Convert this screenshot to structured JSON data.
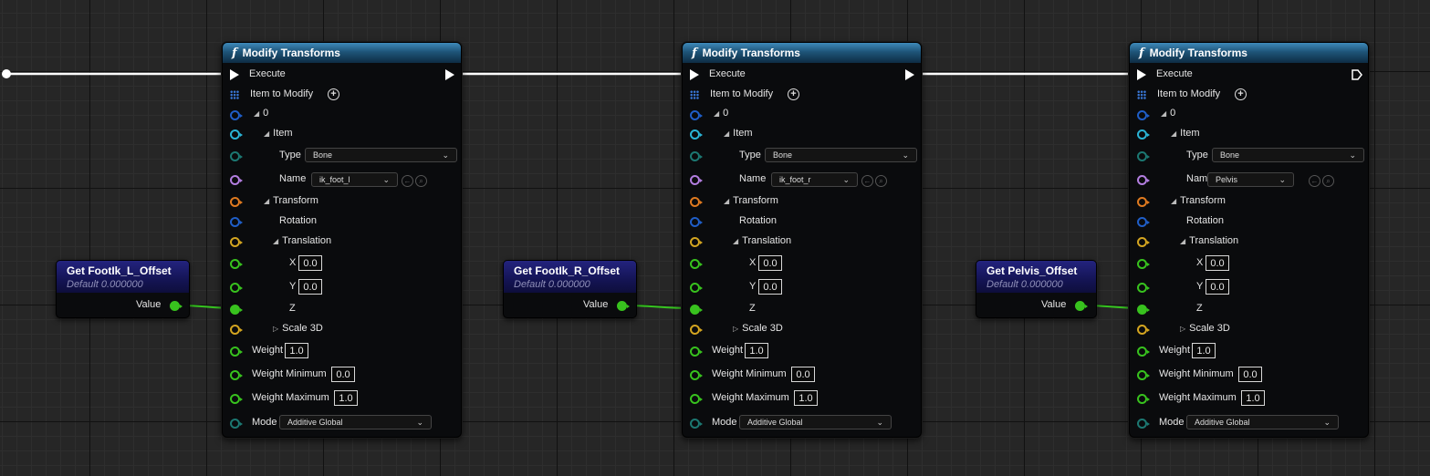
{
  "nodes": [
    {
      "title": "Modify Transforms",
      "execute_label": "Execute",
      "item_to_modify_label": "Item to Modify",
      "index_label": "0",
      "item_label": "Item",
      "type_label": "Type",
      "type_value": "Bone",
      "name_label": "Name",
      "name_value": "ik_foot_l",
      "transform_label": "Transform",
      "rotation_label": "Rotation",
      "translation_label": "Translation",
      "x_label": "X",
      "x_value": "0.0",
      "y_label": "Y",
      "y_value": "0.0",
      "z_label": "Z",
      "scale_label": "Scale 3D",
      "weight_label": "Weight",
      "weight_value": "1.0",
      "weight_min_label": "Weight Minimum",
      "weight_min_value": "0.0",
      "weight_max_label": "Weight Maximum",
      "weight_max_value": "1.0",
      "mode_label": "Mode",
      "mode_value": "Additive Global"
    },
    {
      "title": "Modify Transforms",
      "execute_label": "Execute",
      "item_to_modify_label": "Item to Modify",
      "index_label": "0",
      "item_label": "Item",
      "type_label": "Type",
      "type_value": "Bone",
      "name_label": "Name",
      "name_value": "ik_foot_r",
      "transform_label": "Transform",
      "rotation_label": "Rotation",
      "translation_label": "Translation",
      "x_label": "X",
      "x_value": "0.0",
      "y_label": "Y",
      "y_value": "0.0",
      "z_label": "Z",
      "scale_label": "Scale 3D",
      "weight_label": "Weight",
      "weight_value": "1.0",
      "weight_min_label": "Weight Minimum",
      "weight_min_value": "0.0",
      "weight_max_label": "Weight Maximum",
      "weight_max_value": "1.0",
      "mode_label": "Mode",
      "mode_value": "Additive Global"
    },
    {
      "title": "Modify Transforms",
      "execute_label": "Execute",
      "item_to_modify_label": "Item to Modify",
      "index_label": "0",
      "item_label": "Item",
      "type_label": "Type",
      "type_value": "Bone",
      "name_label": "Name",
      "name_value": "Pelvis",
      "transform_label": "Transform",
      "rotation_label": "Rotation",
      "translation_label": "Translation",
      "x_label": "X",
      "x_value": "0.0",
      "y_label": "Y",
      "y_value": "0.0",
      "z_label": "Z",
      "scale_label": "Scale 3D",
      "weight_label": "Weight",
      "weight_value": "1.0",
      "weight_min_label": "Weight Minimum",
      "weight_min_value": "0.0",
      "weight_max_label": "Weight Maximum",
      "weight_max_value": "1.0",
      "mode_label": "Mode",
      "mode_value": "Additive Global"
    }
  ],
  "getters": [
    {
      "title": "Get FootIk_L_Offset",
      "subtitle": "Default 0.000000",
      "value_label": "Value"
    },
    {
      "title": "Get FootIk_R_Offset",
      "subtitle": "Default 0.000000",
      "value_label": "Value"
    },
    {
      "title": "Get Pelvis_Offset",
      "subtitle": "Default 0.000000",
      "value_label": "Value"
    }
  ],
  "colors": {
    "exec_wire": "#ffffff",
    "float_wire": "#35c41f",
    "pin_blue": "#1f5ec8",
    "pin_cyan": "#2ab4d6",
    "pin_teal": "#1c7872",
    "pin_purple": "#b37ee0",
    "pin_orange": "#e07a1f",
    "pin_yellow": "#d4a520",
    "pin_green": "#38c21e"
  }
}
